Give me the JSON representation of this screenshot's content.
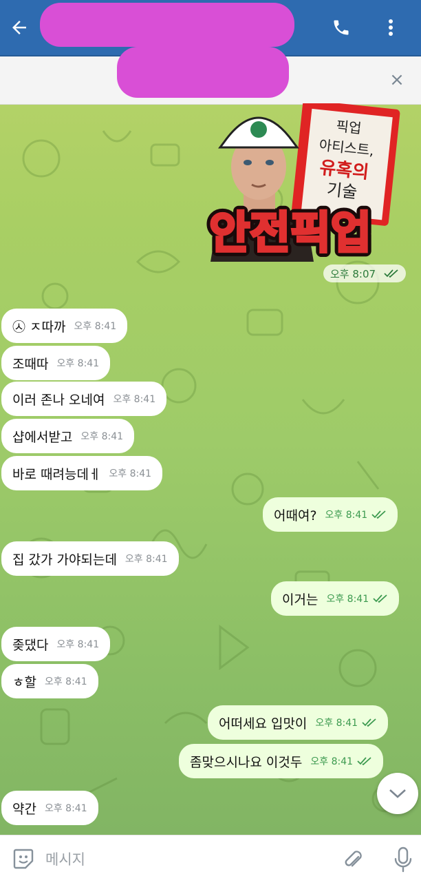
{
  "colors": {
    "header": "#2e6bb0",
    "incoming": "#ffffff",
    "outgoing": "#eeffdd",
    "time_out": "#3c9a4f",
    "redaction": "#d94fd6"
  },
  "header": {
    "back_icon": "arrow-left-icon",
    "call_icon": "phone-icon",
    "more_icon": "dots-vertical-icon"
  },
  "pinned": {
    "close_label": "×"
  },
  "sticker": {
    "book_title": [
      "픽업",
      "아티스트,",
      "유혹의",
      "기술"
    ],
    "banner": "안전픽업",
    "time": "오후 8:07"
  },
  "messages": [
    {
      "text": "㉦ ㅈ따까",
      "time": "오후 8:41"
    },
    {
      "text": "조때따",
      "time": "오후 8:41"
    },
    {
      "text": "이러 존나 오네여",
      "time": "오후 8:41"
    },
    {
      "text": "샵에서받고",
      "time": "오후 8:41"
    },
    {
      "text": "바로 때려능데ㅔ",
      "time": "오후 8:41"
    },
    {
      "text": "어때여?",
      "time": "오후 8:41"
    },
    {
      "text": "집 갔가 가야되는데",
      "time": "오후 8:41"
    },
    {
      "text": "이거는",
      "time": "오후 8:41"
    },
    {
      "text": "좆댔다",
      "time": "오후 8:41"
    },
    {
      "text": "ㅎ할",
      "time": "오후 8:41"
    },
    {
      "text": "어떠세요 입맛이",
      "time": "오후 8:41"
    },
    {
      "text": "좀맞으시나요 이것두",
      "time": "오후 8:41"
    },
    {
      "text": "약간",
      "time": "오후 8:41"
    }
  ],
  "composer": {
    "placeholder": "메시지"
  }
}
